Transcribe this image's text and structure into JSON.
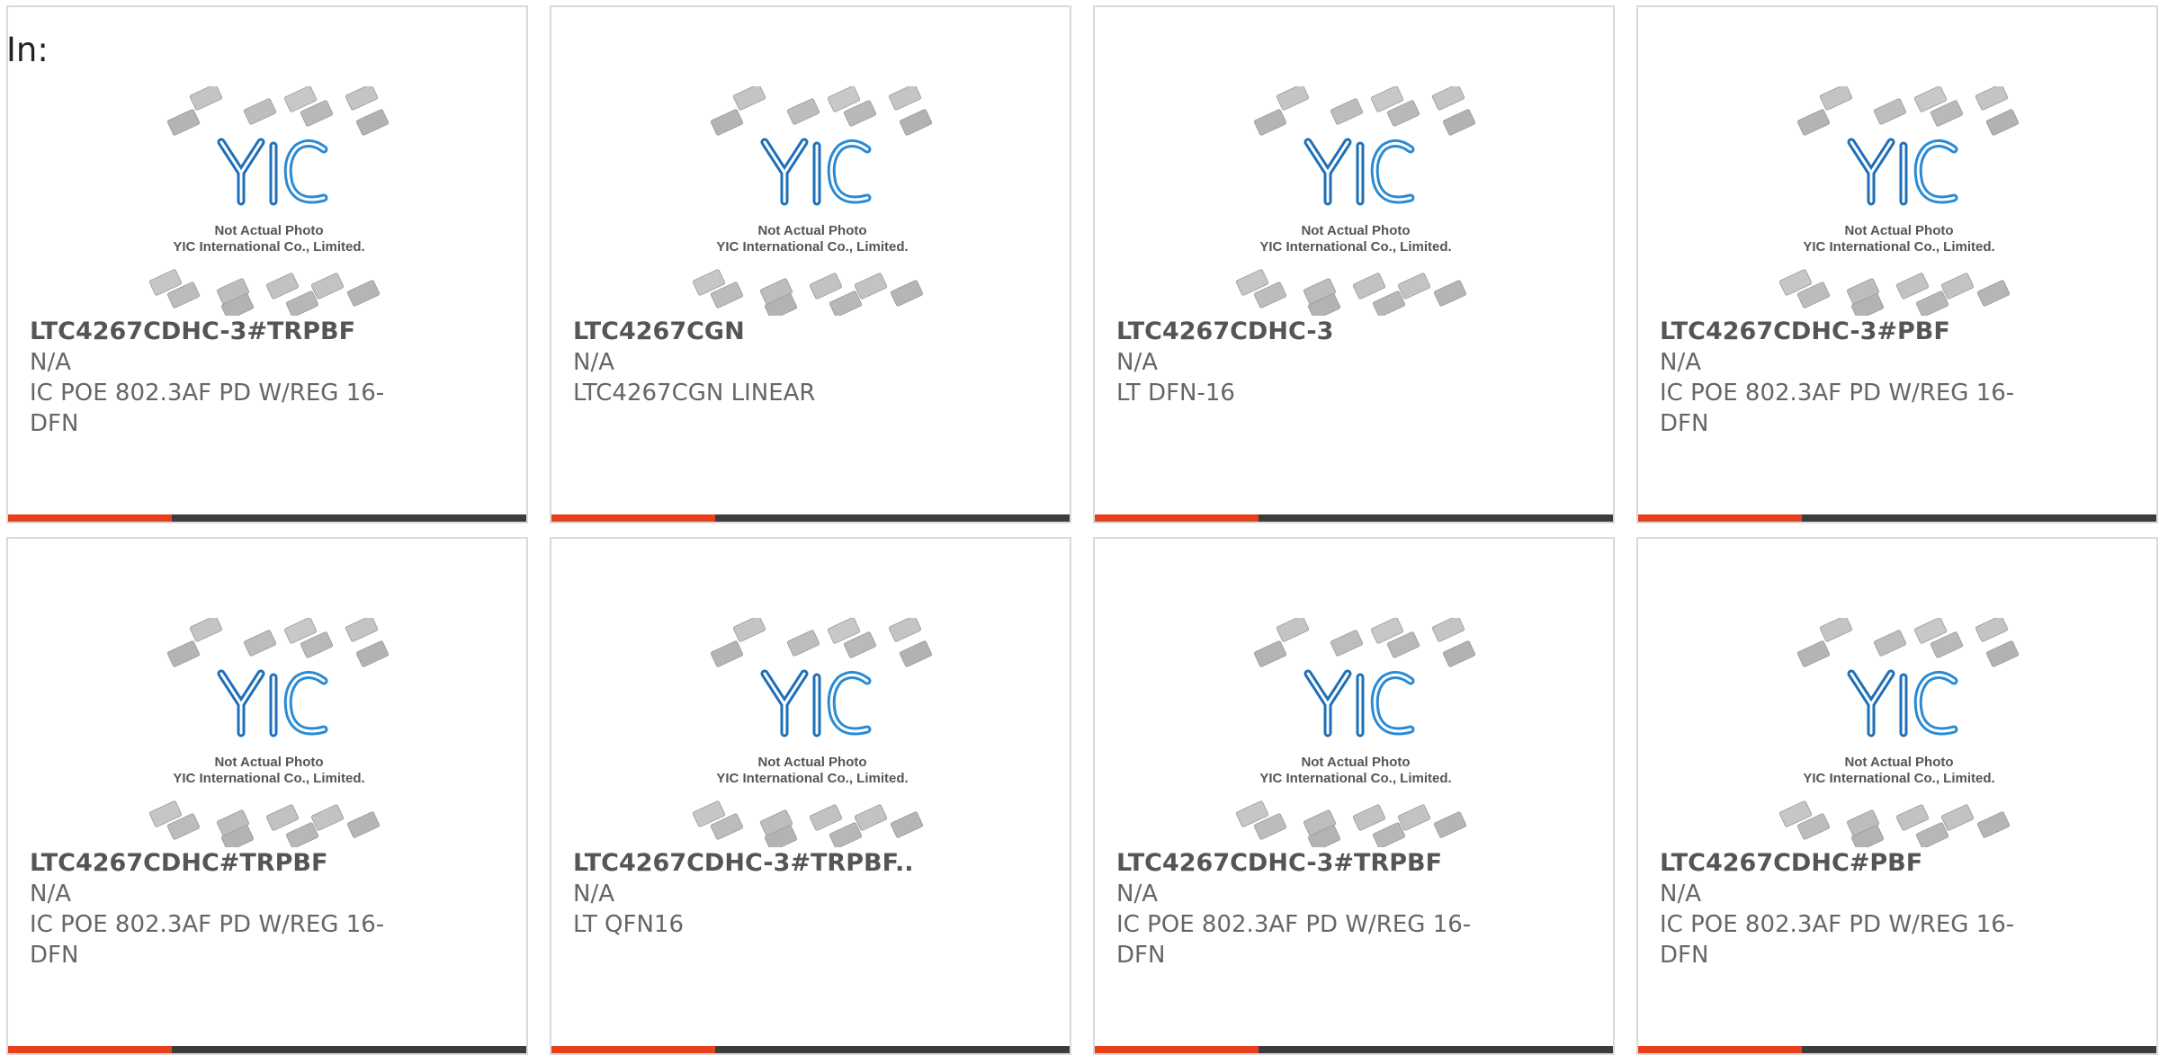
{
  "in_label": "In:",
  "accent_color": "#e8401c",
  "bar_color": "#3c3c3c",
  "image_caption": {
    "line1": "Not Actual Photo",
    "line2": "YIC International Co., Limited.",
    "logo_text": "YIC"
  },
  "products": [
    {
      "part": "LTC4267CDHC-3#TRPBF",
      "manufacturer": "N/A",
      "description": "IC POE 802.3AF PD W/REG 16-DFN"
    },
    {
      "part": "LTC4267CGN",
      "manufacturer": "N/A",
      "description": "LTC4267CGN LINEAR"
    },
    {
      "part": "LTC4267CDHC-3",
      "manufacturer": "N/A",
      "description": "LT DFN-16"
    },
    {
      "part": "LTC4267CDHC-3#PBF",
      "manufacturer": "N/A",
      "description": "IC POE 802.3AF PD W/REG 16-DFN"
    },
    {
      "part": "LTC4267CDHC#TRPBF",
      "manufacturer": "N/A",
      "description": "IC POE 802.3AF PD W/REG 16-DFN"
    },
    {
      "part": "LTC4267CDHC-3#TRPBF..",
      "manufacturer": "N/A",
      "description": "LT QFN16"
    },
    {
      "part": "LTC4267CDHC-3#TRPBF",
      "manufacturer": "N/A",
      "description": "IC POE 802.3AF PD W/REG 16-DFN"
    },
    {
      "part": "LTC4267CDHC#PBF",
      "manufacturer": "N/A",
      "description": "IC POE 802.3AF PD W/REG 16-DFN"
    }
  ]
}
